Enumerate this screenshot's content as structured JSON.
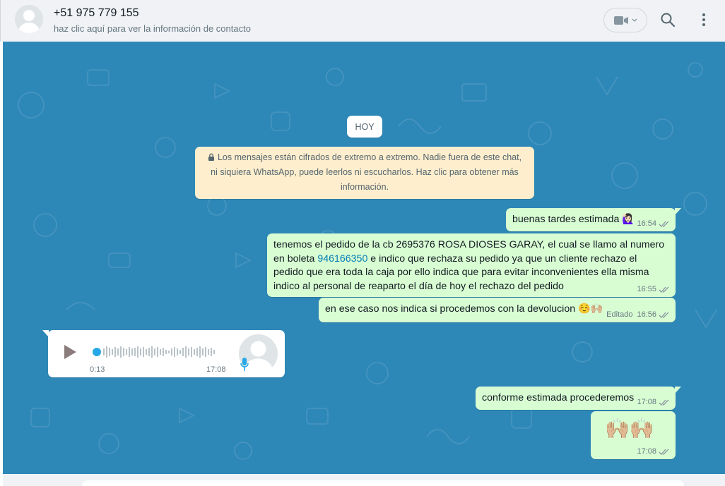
{
  "header": {
    "contact_name": "+51 975 779 155",
    "contact_subtitle": "haz clic aquí para ver la información de contacto",
    "icons": [
      "avatar-default",
      "video-call-icon",
      "chevron-down-icon",
      "search-icon",
      "menu-icon"
    ]
  },
  "chat": {
    "date_label": "HOY",
    "encryption_notice": "Los mensajes están cifrados de extremo a extremo. Nadie fuera de este chat, ni siquiera WhatsApp, puede leerlos ni escucharlos. Haz clic para obtener más información.",
    "messages": [
      {
        "text": "buenas tardes estimada",
        "emoji": "🙋🏻‍♀️",
        "time": "16:54",
        "status": "read"
      },
      {
        "text_before": "tenemos el pedido de la cb 2695376 ROSA DIOSES GARAY, el cual se llamo al numero en boleta ",
        "phone_link": "946166350",
        "text_after": " e indico que rechaza su pedido ya que un cliente rechazo el pedido que era toda la caja por ello indica que para evitar inconvenientes ella misma indico al personal de reaparto el día de hoy el rechazo del pedido",
        "time": "16:55",
        "status": "read"
      },
      {
        "text": "en ese caso nos indica si procedemos con la devolucion",
        "emoji": "☺️🙌🏼",
        "edited_label": "Editado",
        "time": "16:56",
        "status": "read"
      },
      {
        "type": "voice",
        "duration": "0:13",
        "time": "17:08"
      },
      {
        "text": "conforme estimada procederemos",
        "time": "17:08",
        "status": "read"
      },
      {
        "emoji": "🙌🏼🙌🏼",
        "time": "17:08",
        "status": "read"
      }
    ]
  },
  "colors": {
    "chat_bg": "#2e88b7",
    "outgoing_bubble": "#d9fdd3",
    "incoming_bubble": "#ffffff",
    "notice_bg": "#ffeecd",
    "read_tick": "#53bdeb",
    "link": "#027eb5"
  }
}
